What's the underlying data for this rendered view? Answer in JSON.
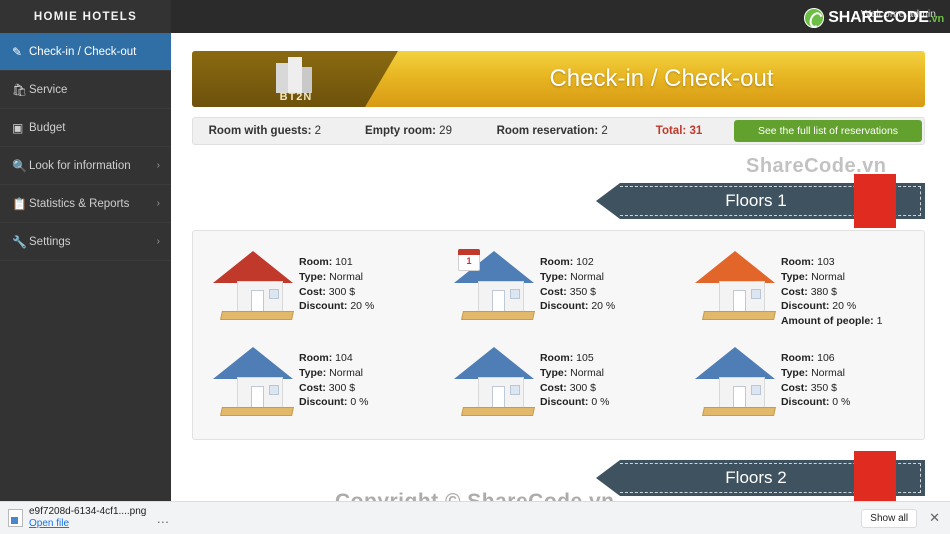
{
  "topbar": {
    "brand": "HOMIE HOTELS",
    "welcome": "Welcome admin",
    "logo_text": "SHARECODE",
    "logo_suffix": ".vn"
  },
  "sidebar": {
    "items": [
      {
        "label": "Check-in / Check-out",
        "icon": "edit-square-icon",
        "active": true,
        "chevron": ""
      },
      {
        "label": "Service",
        "icon": "cart-icon",
        "active": false,
        "chevron": ""
      },
      {
        "label": "Budget",
        "icon": "money-icon",
        "active": false,
        "chevron": ""
      },
      {
        "label": "Look for information",
        "icon": "search-icon",
        "active": false,
        "chevron": "›"
      },
      {
        "label": "Statistics & Reports",
        "icon": "clipboard-icon",
        "active": false,
        "chevron": "›"
      },
      {
        "label": "Settings",
        "icon": "wrench-icon",
        "active": false,
        "chevron": "›"
      }
    ]
  },
  "banner": {
    "logo_caption": "BT2N",
    "title": "Check-in / Check-out"
  },
  "stats": {
    "rooms_with_guests_label": "Room with guests:",
    "rooms_with_guests_value": "2",
    "empty_rooms_label": "Empty room:",
    "empty_rooms_value": "29",
    "reservation_label": "Room reservation:",
    "reservation_value": "2",
    "total_label": "Total:",
    "total_value": "31",
    "button_label": "See the full list of reservations"
  },
  "floors": [
    {
      "heading": "Floors 1",
      "rooms": [
        {
          "room_label": "Room:",
          "room": "101",
          "type_label": "Type:",
          "type": "Normal",
          "cost_label": "Cost:",
          "cost": "300 $",
          "discount_label": "Discount:",
          "discount": "20 %",
          "people_label": "",
          "people": "",
          "roof_color": "#c0392b",
          "body_color": "#f3f3f3",
          "badge": ""
        },
        {
          "room_label": "Room:",
          "room": "102",
          "type_label": "Type:",
          "type": "Normal",
          "cost_label": "Cost:",
          "cost": "350 $",
          "discount_label": "Discount:",
          "discount": "20 %",
          "people_label": "",
          "people": "",
          "roof_color": "#4f7db5",
          "body_color": "#f3f3f3",
          "badge": "1"
        },
        {
          "room_label": "Room:",
          "room": "103",
          "type_label": "Type:",
          "type": "Normal",
          "cost_label": "Cost:",
          "cost": "380 $",
          "discount_label": "Discount:",
          "discount": "20 %",
          "people_label": "Amount of people:",
          "people": "1",
          "roof_color": "#e2662a",
          "body_color": "#f3f3f3",
          "badge": ""
        },
        {
          "room_label": "Room:",
          "room": "104",
          "type_label": "Type:",
          "type": "Normal",
          "cost_label": "Cost:",
          "cost": "300 $",
          "discount_label": "Discount:",
          "discount": "0 %",
          "people_label": "",
          "people": "",
          "roof_color": "#4f7db5",
          "body_color": "#f3f3f3",
          "badge": ""
        },
        {
          "room_label": "Room:",
          "room": "105",
          "type_label": "Type:",
          "type": "Normal",
          "cost_label": "Cost:",
          "cost": "300 $",
          "discount_label": "Discount:",
          "discount": "0 %",
          "people_label": "",
          "people": "",
          "roof_color": "#4f7db5",
          "body_color": "#f3f3f3",
          "badge": ""
        },
        {
          "room_label": "Room:",
          "room": "106",
          "type_label": "Type:",
          "type": "Normal",
          "cost_label": "Cost:",
          "cost": "350 $",
          "discount_label": "Discount:",
          "discount": "0 %",
          "people_label": "",
          "people": "",
          "roof_color": "#4f7db5",
          "body_color": "#f3f3f3",
          "badge": ""
        }
      ]
    },
    {
      "heading": "Floors 2",
      "rooms": []
    }
  ],
  "watermarks": {
    "top": "ShareCode.vn",
    "bottom": "Copyright © ShareCode.vn"
  },
  "downloads": {
    "filename": "e9f7208d-6134-4cf1....png",
    "open_label": "Open file",
    "menu_dots": "…",
    "show_all": "Show all",
    "close": "✕"
  }
}
